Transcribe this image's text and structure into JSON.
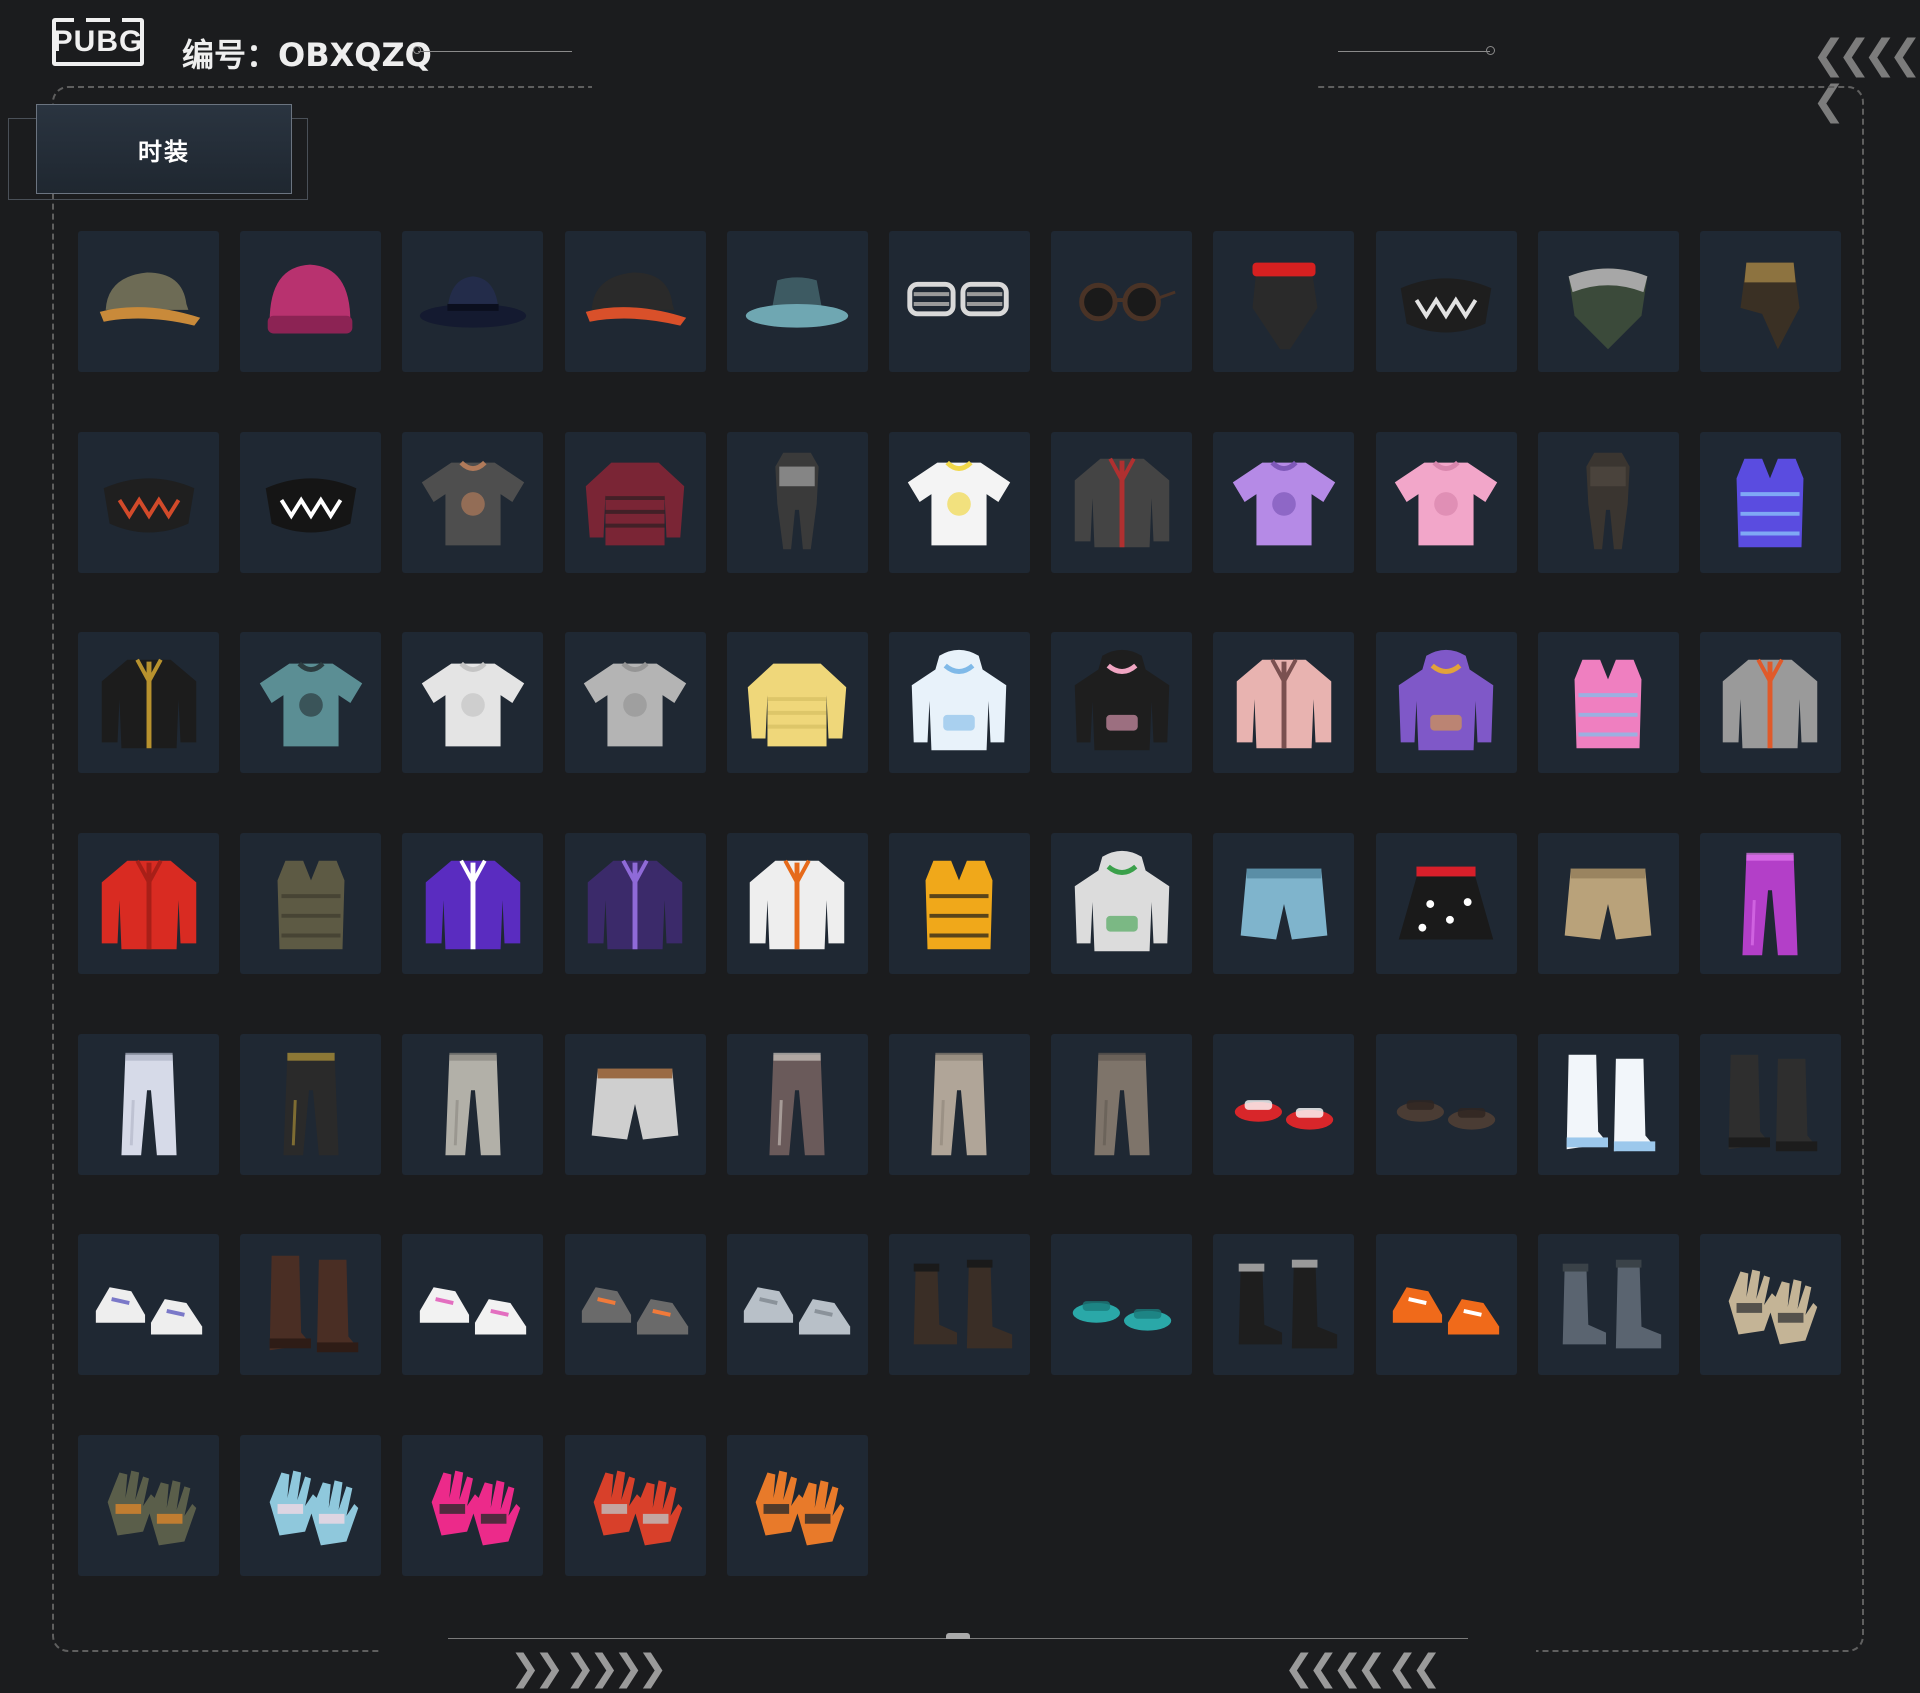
{
  "header": {
    "logo_text": "PUBG",
    "code_label": "编号：OBXQZQ"
  },
  "tabs": [
    {
      "label": "时装",
      "active": true
    }
  ],
  "decor": {
    "top_chevrons": "❮❮❮❮ ❮",
    "bottom_left_chevrons": "❯❯ ❯❯❯❯",
    "bottom_right_chevrons": "❮❮❮❮ ❮❮"
  },
  "colors": {
    "background": "#1b1c1e",
    "tile": "#1f2833",
    "frame_dash": "#5f5f5f"
  },
  "items": [
    {
      "icon": "headset-cap-icon",
      "kind": "cap",
      "c1": "#6d6b55",
      "c2": "#c98a3a"
    },
    {
      "icon": "beanie-icon",
      "kind": "beanie",
      "c1": "#b8326f",
      "c2": "#8c2354"
    },
    {
      "icon": "fedora-hat-icon",
      "kind": "fedora",
      "c1": "#232c4a",
      "c2": "#141a30"
    },
    {
      "icon": "baseball-cap-icon",
      "kind": "cap",
      "c1": "#2a2a2a",
      "c2": "#d9502a"
    },
    {
      "icon": "bucket-hat-icon",
      "kind": "bucket",
      "c1": "#3d5a62",
      "c2": "#6fa7b2"
    },
    {
      "icon": "shutter-glasses-icon",
      "kind": "shutter",
      "c1": "#d9d9d9",
      "c2": "#9a9a9a"
    },
    {
      "icon": "round-goggles-icon",
      "kind": "goggles",
      "c1": "#4a3326",
      "c2": "#1a1a1a"
    },
    {
      "icon": "red-visor-mask-icon",
      "kind": "mask",
      "c1": "#2a2a2a",
      "c2": "#d62020"
    },
    {
      "icon": "spiked-face-mask-icon",
      "kind": "facemask",
      "c1": "#1e1e1e",
      "c2": "#e2e2e2"
    },
    {
      "icon": "camo-balaclava-icon",
      "kind": "scarf",
      "c1": "#3b4a3a",
      "c2": "#a7a7a7"
    },
    {
      "icon": "bandana-icon",
      "kind": "bandana",
      "c1": "#3a3024",
      "c2": "#8d7340"
    },
    {
      "icon": "black-face-mask-icon",
      "kind": "facemask",
      "c1": "#1f1f1f",
      "c2": "#d24a2a"
    },
    {
      "icon": "shark-teeth-mask-icon",
      "kind": "facemask",
      "c1": "#151515",
      "c2": "#ffffff"
    },
    {
      "icon": "tattoo-tshirt-icon",
      "kind": "tshirt",
      "c1": "#4e4e4e",
      "c2": "#b07a5a"
    },
    {
      "icon": "striped-sweater-icon",
      "kind": "sweater",
      "c1": "#7a2535",
      "c2": "#1e1e1e"
    },
    {
      "icon": "dress-outfit-icon",
      "kind": "outfit",
      "c1": "#3a3a3a",
      "c2": "#cfcfcf"
    },
    {
      "icon": "chick-tshirt-icon",
      "kind": "tshirt",
      "c1": "#f4f4f4",
      "c2": "#f1d84b"
    },
    {
      "icon": "armor-jacket-icon",
      "kind": "jacket",
      "c1": "#444444",
      "c2": "#b03030"
    },
    {
      "icon": "purple-tshirt-icon",
      "kind": "tshirt",
      "c1": "#b58ae6",
      "c2": "#7e58b8"
    },
    {
      "icon": "pink-tshirt-icon",
      "kind": "tshirt",
      "c1": "#f2a6c9",
      "c2": "#d886ad"
    },
    {
      "icon": "leather-outfit-icon",
      "kind": "outfit",
      "c1": "#3a3530",
      "c2": "#5a5248"
    },
    {
      "icon": "purple-puffer-vest-icon",
      "kind": "vest",
      "c1": "#5a4ce0",
      "c2": "#8fd0ff"
    },
    {
      "icon": "black-shirt-icon",
      "kind": "jacket",
      "c1": "#1c1c1c",
      "c2": "#b8922e"
    },
    {
      "icon": "floral-shirt-icon",
      "kind": "tshirt",
      "c1": "#5b8e94",
      "c2": "#2c3c40"
    },
    {
      "icon": "white-tshirt-icon",
      "kind": "tshirt",
      "c1": "#e4e4e4",
      "c2": "#c4c4c4"
    },
    {
      "icon": "grey-tshirt-icon",
      "kind": "tshirt",
      "c1": "#b4b4b4",
      "c2": "#959595"
    },
    {
      "icon": "yellow-sweater-icon",
      "kind": "sweater",
      "c1": "#efd77a",
      "c2": "#d2bb5e"
    },
    {
      "icon": "white-bunny-hoodie-icon",
      "kind": "hoodie",
      "c1": "#e8f2fa",
      "c2": "#7fb9e8"
    },
    {
      "icon": "black-cat-hoodie-icon",
      "kind": "hoodie",
      "c1": "#1e1e1e",
      "c2": "#f0a5c2"
    },
    {
      "icon": "pink-bomber-jacket-icon",
      "kind": "jacket",
      "c1": "#e8b3b0",
      "c2": "#7a5050"
    },
    {
      "icon": "graffiti-hoodie-icon",
      "kind": "hoodie",
      "c1": "#7f58c8",
      "c2": "#e2a23a"
    },
    {
      "icon": "holo-puffer-vest-icon",
      "kind": "vest",
      "c1": "#ef7fc0",
      "c2": "#7ac4ef"
    },
    {
      "icon": "silver-jacket-icon",
      "kind": "jacket",
      "c1": "#9a9a9a",
      "c2": "#e05a2a"
    },
    {
      "icon": "red-crop-jacket-icon",
      "kind": "jacket",
      "c1": "#d92b22",
      "c2": "#a81f18"
    },
    {
      "icon": "tactical-vest-icon",
      "kind": "vest",
      "c1": "#5d5a44",
      "c2": "#3e3c2e"
    },
    {
      "icon": "purple-track-jacket-icon",
      "kind": "jacket",
      "c1": "#5a2cc0",
      "c2": "#ffffff"
    },
    {
      "icon": "purple-camo-jacket-icon",
      "kind": "jacket",
      "c1": "#3b2a6a",
      "c2": "#8f6ad8"
    },
    {
      "icon": "white-orange-jacket-icon",
      "kind": "jacket",
      "c1": "#eeeeee",
      "c2": "#e66a1a"
    },
    {
      "icon": "yellow-puffer-vest-icon",
      "kind": "vest",
      "c1": "#f0a81a",
      "c2": "#1a1a1a"
    },
    {
      "icon": "green-leaf-hoodie-icon",
      "kind": "hoodie",
      "c1": "#dcdcdc",
      "c2": "#3aa04a"
    },
    {
      "icon": "denim-shorts-icon",
      "kind": "shorts",
      "c1": "#7fb4cc",
      "c2": "#5a8ea6"
    },
    {
      "icon": "polka-dot-skirt-icon",
      "kind": "skirt",
      "c1": "#1a1a1a",
      "c2": "#d81f2a"
    },
    {
      "icon": "khaki-shorts-icon",
      "kind": "shorts",
      "c1": "#b9a27a",
      "c2": "#9a8460"
    },
    {
      "icon": "purple-metallic-pants-icon",
      "kind": "pants",
      "c1": "#b33fc8",
      "c2": "#e27af0"
    },
    {
      "icon": "white-cargo-pants-icon",
      "kind": "pants",
      "c1": "#d6dae8",
      "c2": "#aeb3c4"
    },
    {
      "icon": "black-pants-icon",
      "kind": "pants",
      "c1": "#2a2a2a",
      "c2": "#b89a3a"
    },
    {
      "icon": "grey-cargo-pants-icon",
      "kind": "pants",
      "c1": "#b2b0a8",
      "c2": "#8a8880"
    },
    {
      "icon": "white-shorts-icon",
      "kind": "shorts",
      "c1": "#cfcfcf",
      "c2": "#9a6a44"
    },
    {
      "icon": "camo-pants-icon",
      "kind": "pants",
      "c1": "#6a5a5a",
      "c2": "#cfc7c0"
    },
    {
      "icon": "beige-pants-icon",
      "kind": "pants",
      "c1": "#b0a598",
      "c2": "#8e8478"
    },
    {
      "icon": "brown-pants-icon",
      "kind": "pants",
      "c1": "#7e746a",
      "c2": "#625a52"
    },
    {
      "icon": "red-slides-icon",
      "kind": "slides",
      "c1": "#d8262a",
      "c2": "#ffffff"
    },
    {
      "icon": "paw-slippers-icon",
      "kind": "slides",
      "c1": "#4a3c34",
      "c2": "#2e2420"
    },
    {
      "icon": "white-fur-boots-icon",
      "kind": "tallboots",
      "c1": "#f2f6fa",
      "c2": "#9cc8ec"
    },
    {
      "icon": "black-fur-boots-icon",
      "kind": "tallboots",
      "c1": "#2e2e2e",
      "c2": "#1c1c1c"
    },
    {
      "icon": "white-sneakers-icon",
      "kind": "sneakers",
      "c1": "#eeeeee",
      "c2": "#7a78c8"
    },
    {
      "icon": "brown-tall-boots-icon",
      "kind": "tallboots",
      "c1": "#4a2e24",
      "c2": "#2e1c16"
    },
    {
      "icon": "pink-sneakers-icon",
      "kind": "sneakers",
      "c1": "#f2f2f2",
      "c2": "#e36fc0"
    },
    {
      "icon": "grey-orange-sneakers-icon",
      "kind": "sneakers",
      "c1": "#6a6a6a",
      "c2": "#f07a3a"
    },
    {
      "icon": "winged-sneakers-icon",
      "kind": "sneakers",
      "c1": "#b8c0c8",
      "c2": "#8a929a"
    },
    {
      "icon": "combat-boots-icon",
      "kind": "boots",
      "c1": "#3a2e26",
      "c2": "#1a1a1a"
    },
    {
      "icon": "teal-clogs-icon",
      "kind": "slides",
      "c1": "#2aa8a8",
      "c2": "#1a7a7a"
    },
    {
      "icon": "fur-trim-boots-icon",
      "kind": "boots",
      "c1": "#1e1e1e",
      "c2": "#9a9a9a"
    },
    {
      "icon": "orange-high-tops-icon",
      "kind": "sneakers",
      "c1": "#f06a1a",
      "c2": "#ffffff"
    },
    {
      "icon": "camo-boots-icon",
      "kind": "boots",
      "c1": "#5a6470",
      "c2": "#3a4248"
    },
    {
      "icon": "fingerless-gloves-icon",
      "kind": "gloves",
      "c1": "#c4b496",
      "c2": "#3a3a3a"
    },
    {
      "icon": "camo-gloves-icon",
      "kind": "gloves",
      "c1": "#5a5e4a",
      "c2": "#d9852a"
    },
    {
      "icon": "blue-spiked-gloves-icon",
      "kind": "gloves",
      "c1": "#8fc8dc",
      "c2": "#f0d8e4"
    },
    {
      "icon": "pink-gloves-icon",
      "kind": "gloves",
      "c1": "#ec2a8a",
      "c2": "#2a2a2a"
    },
    {
      "icon": "red-moto-gloves-icon",
      "kind": "gloves",
      "c1": "#d8402a",
      "c2": "#bfbfbf"
    },
    {
      "icon": "orange-tactical-gloves-icon",
      "kind": "gloves",
      "c1": "#e87a2a",
      "c2": "#2a2a2a"
    }
  ]
}
